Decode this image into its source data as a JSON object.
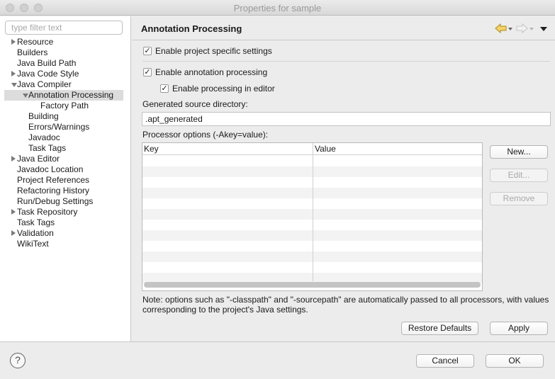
{
  "window": {
    "title": "Properties for sample"
  },
  "filter": {
    "placeholder": "type filter text"
  },
  "tree": [
    {
      "label": "Resource",
      "level": 0,
      "twisty": "closed"
    },
    {
      "label": "Builders",
      "level": 0,
      "twisty": "none"
    },
    {
      "label": "Java Build Path",
      "level": 0,
      "twisty": "none"
    },
    {
      "label": "Java Code Style",
      "level": 0,
      "twisty": "closed"
    },
    {
      "label": "Java Compiler",
      "level": 0,
      "twisty": "open"
    },
    {
      "label": "Annotation Processing",
      "level": 1,
      "twisty": "open",
      "selected": true
    },
    {
      "label": "Factory Path",
      "level": 2,
      "twisty": "none"
    },
    {
      "label": "Building",
      "level": 1,
      "twisty": "none"
    },
    {
      "label": "Errors/Warnings",
      "level": 1,
      "twisty": "none"
    },
    {
      "label": "Javadoc",
      "level": 1,
      "twisty": "none"
    },
    {
      "label": "Task Tags",
      "level": 1,
      "twisty": "none"
    },
    {
      "label": "Java Editor",
      "level": 0,
      "twisty": "closed"
    },
    {
      "label": "Javadoc Location",
      "level": 0,
      "twisty": "none"
    },
    {
      "label": "Project References",
      "level": 0,
      "twisty": "none"
    },
    {
      "label": "Refactoring History",
      "level": 0,
      "twisty": "none"
    },
    {
      "label": "Run/Debug Settings",
      "level": 0,
      "twisty": "none"
    },
    {
      "label": "Task Repository",
      "level": 0,
      "twisty": "closed"
    },
    {
      "label": "Task Tags",
      "level": 0,
      "twisty": "none"
    },
    {
      "label": "Validation",
      "level": 0,
      "twisty": "closed"
    },
    {
      "label": "WikiText",
      "level": 0,
      "twisty": "none"
    }
  ],
  "page": {
    "title": "Annotation Processing",
    "nav_icons": [
      "back-arrow-icon",
      "forward-arrow-icon",
      "view-menu-icon"
    ],
    "enable_project_specific": {
      "label": "Enable project specific settings",
      "checked": true
    },
    "enable_annotation_processing": {
      "label": "Enable annotation processing",
      "checked": true
    },
    "enable_processing_in_editor": {
      "label": "Enable processing in editor",
      "checked": true
    },
    "generated_source_dir_label": "Generated source directory:",
    "generated_source_dir_value": ".apt_generated",
    "processor_options_label": "Processor options (-Akey=value):",
    "table": {
      "columns": [
        "Key",
        "Value"
      ],
      "rows": []
    },
    "buttons": {
      "new": "New...",
      "edit": "Edit...",
      "remove": "Remove"
    },
    "note": "Note: options such as \"-classpath\" and \"-sourcepath\" are automatically passed to all processors, with values corresponding to the project's Java settings.",
    "restore_defaults": "Restore Defaults",
    "apply": "Apply"
  },
  "footer": {
    "help": "?",
    "cancel": "Cancel",
    "ok": "OK"
  }
}
